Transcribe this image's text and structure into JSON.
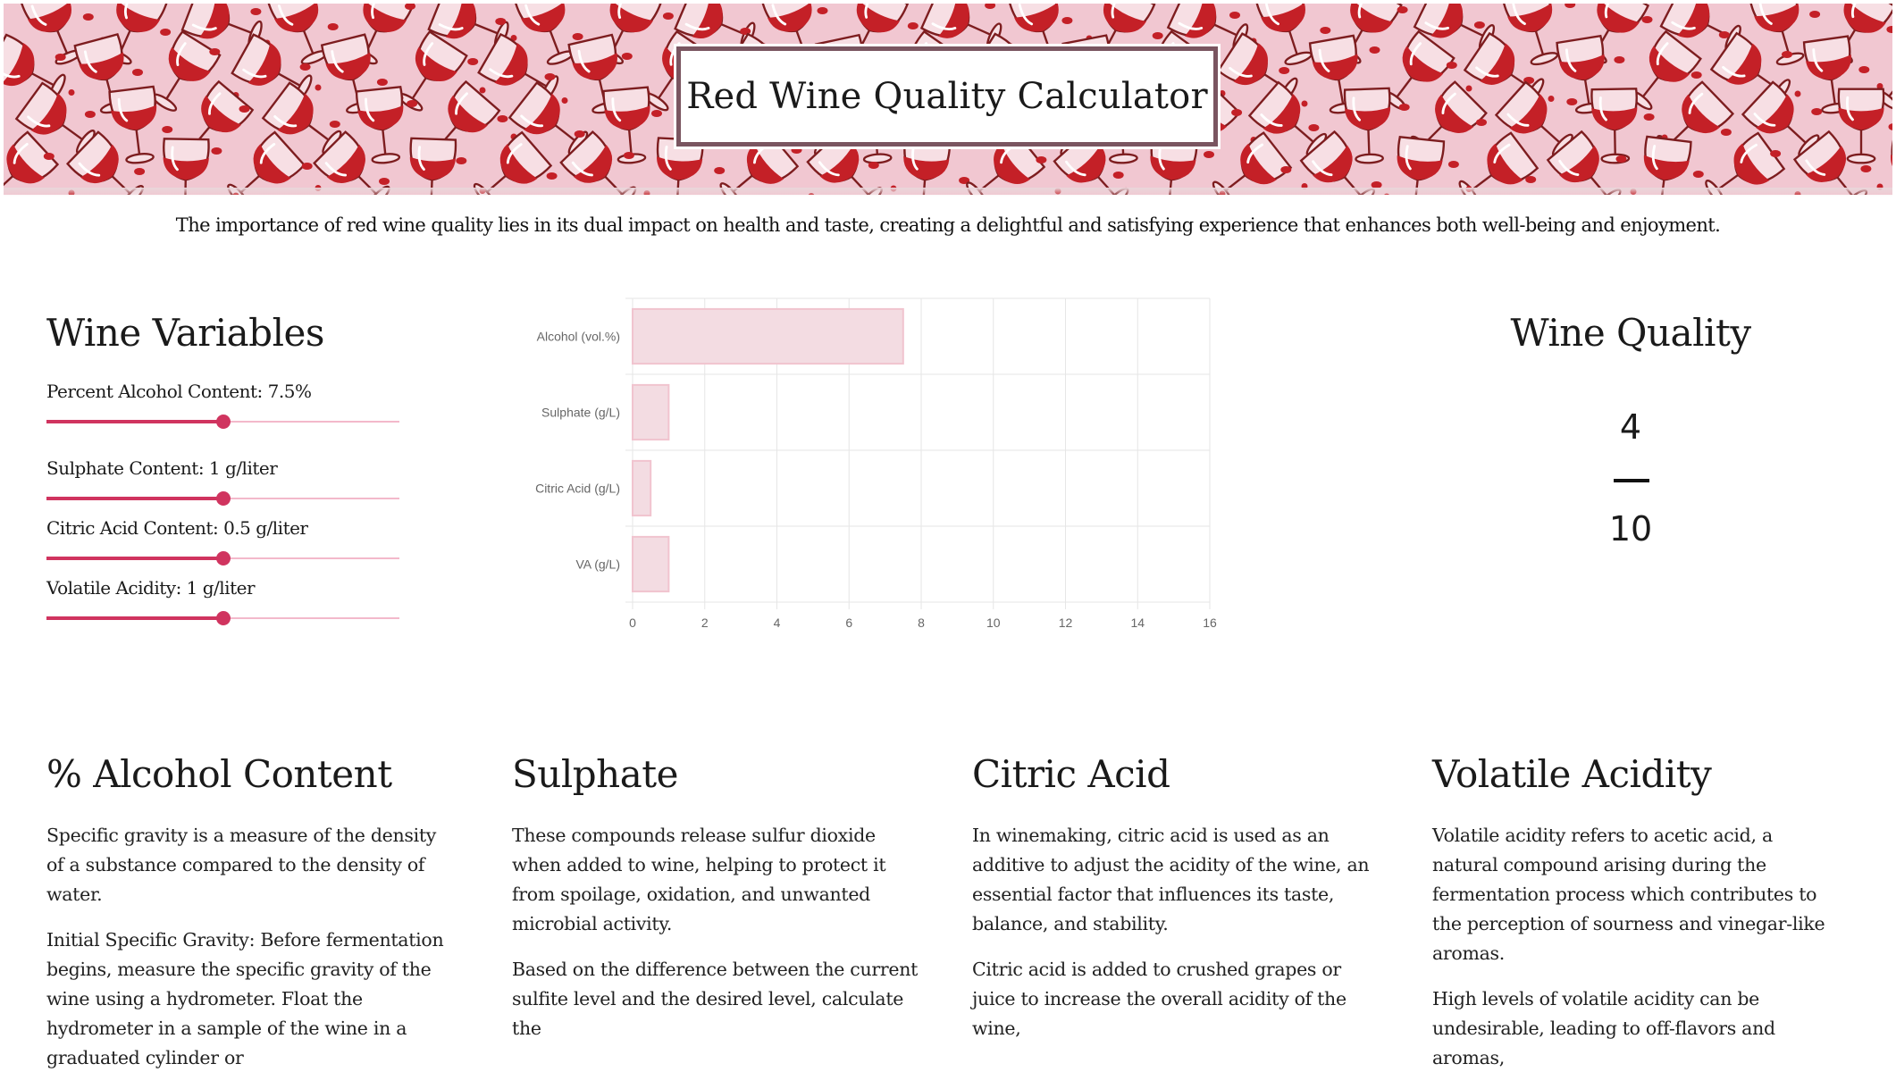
{
  "header": {
    "title": "Red Wine Quality Calculator",
    "intro": "The importance of red wine quality lies in its dual impact on health and taste, creating a delightful and satisfying experience that enhances both well-being and enjoyment."
  },
  "colors": {
    "banner_background": "#f1c7d1",
    "wine_red": "#c42027",
    "slider_accent": "#d0345f",
    "slider_track": "#f3b9cb",
    "bar_fill": "#f3dce2",
    "bar_stroke": "#f1c4cf"
  },
  "variables": {
    "title": "Wine Variables",
    "sliders": [
      {
        "label": "Percent Alcohol Content: 7.5%",
        "value": 7.5,
        "min": 0,
        "max": 15
      },
      {
        "label": "Sulphate Content: 1 g/liter",
        "value": 1,
        "min": 0,
        "max": 2
      },
      {
        "label": "Citric Acid Content: 0.5 g/liter",
        "value": 0.5,
        "min": 0,
        "max": 1
      },
      {
        "label": "Volatile Acidity: 1 g/liter",
        "value": 1,
        "min": 0,
        "max": 2
      }
    ]
  },
  "chart_data": {
    "type": "bar",
    "orientation": "horizontal",
    "categories": [
      "Alcohol (vol.%)",
      "Sulphate (g/L)",
      "Citric Acid (g/L)",
      "VA (g/L)"
    ],
    "values": [
      7.5,
      1,
      0.5,
      1
    ],
    "xlim": [
      0,
      16
    ],
    "x_ticks": [
      "0",
      "2",
      "4",
      "6",
      "8",
      "10",
      "12",
      "14",
      "16"
    ],
    "grid": true,
    "legend": "none"
  },
  "quality": {
    "title": "Wine Quality",
    "score": "4",
    "max": "10"
  },
  "info": [
    {
      "title": "% Alcohol Content",
      "paragraphs": [
        "Specific gravity is a measure of the density of a substance compared to the density of water.",
        "Initial Specific Gravity: Before fermentation begins, measure the specific gravity of the wine using a hydrometer. Float the hydrometer in a sample of the wine in a graduated cylinder or"
      ]
    },
    {
      "title": "Sulphate",
      "paragraphs": [
        "These compounds release sulfur dioxide when added to wine, helping to protect it from spoilage, oxidation, and unwanted microbial activity.",
        "Based on the difference between the current sulfite level and the desired level, calculate the"
      ]
    },
    {
      "title": "Citric Acid",
      "paragraphs": [
        "In winemaking, citric acid is used as an additive to adjust the acidity of the wine, an essential factor that influences its taste, balance, and stability.",
        "Citric acid is added to crushed grapes or juice to increase the overall acidity of the wine,"
      ]
    },
    {
      "title": "Volatile Acidity",
      "paragraphs": [
        "Volatile acidity refers to acetic acid, a natural compound arising during the fermentation process which contributes to the perception of sourness and vinegar-like aromas.",
        "High levels of volatile acidity can be undesirable, leading to off-flavors and aromas,"
      ]
    }
  ]
}
